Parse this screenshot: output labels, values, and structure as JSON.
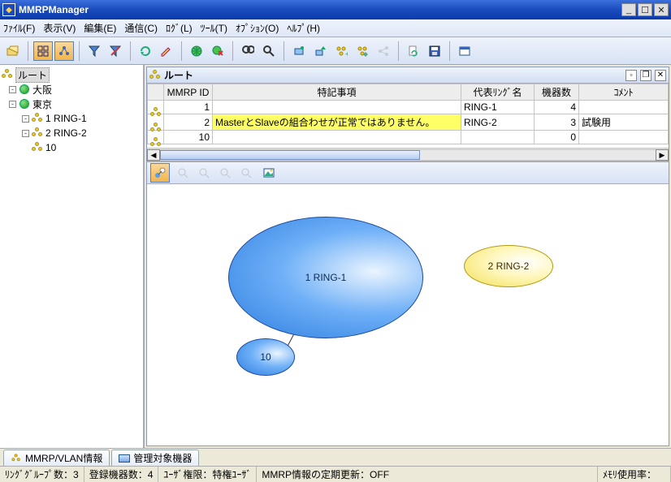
{
  "window": {
    "title": "MMRPManager"
  },
  "menu": {
    "items": [
      "ﾌｧｲﾙ(F)",
      "表示(V)",
      "編集(E)",
      "通信(C)",
      "ﾛｸﾞ(L)",
      "ﾂｰﾙ(T)",
      "ｵﾌﾟｼｮﾝ(O)",
      "ﾍﾙﾌﾟ(H)"
    ]
  },
  "tree": {
    "root": "ルート",
    "nodes": [
      {
        "label": "大阪",
        "depth": 1,
        "icon": "globe"
      },
      {
        "label": "東京",
        "depth": 1,
        "icon": "globe",
        "expanded": true
      },
      {
        "label": "1 RING-1",
        "depth": 2,
        "icon": "ring"
      },
      {
        "label": "2 RING-2",
        "depth": 2,
        "icon": "ring"
      },
      {
        "label": "10",
        "depth": 2,
        "icon": "ring"
      }
    ]
  },
  "subwindow": {
    "title": "ルート"
  },
  "table": {
    "headers": {
      "icon": "",
      "mmrp_id": "MMRP ID",
      "note": "特記事項",
      "ring_name": "代表ﾘﾝｸﾞ名",
      "device_count": "機器数",
      "comment": "ｺﾒﾝﾄ"
    },
    "rows": [
      {
        "id": "1",
        "note": "",
        "note_hl": false,
        "ring": "RING-1",
        "count": "4",
        "comment": ""
      },
      {
        "id": "2",
        "note": "MasterとSlaveの組合わせが正常ではありません。",
        "note_hl": true,
        "ring": "RING-2",
        "count": "3",
        "comment": "試験用"
      },
      {
        "id": "10",
        "note": "",
        "note_hl": false,
        "ring": "",
        "count": "0",
        "comment": ""
      }
    ]
  },
  "canvas": {
    "nodes": {
      "big": "1 RING-1",
      "small": "10",
      "yellow": "2 RING-2"
    }
  },
  "tabs": {
    "t1": "MMRP/VLAN情報",
    "t2": "管理対象機器"
  },
  "status": {
    "ring_groups": "ﾘﾝｸﾞｸﾞﾙｰﾌﾟ数：3",
    "reg_devices": "登録機器数：4",
    "user_priv": "ﾕｰｻﾞ権限：特権ﾕｰｻﾞ",
    "refresh": "MMRP情報の定期更新：OFF",
    "mem": "ﾒﾓﾘ使用率："
  },
  "colors": {
    "accent": "#1b4bbd",
    "highlight": "#ffff66"
  }
}
